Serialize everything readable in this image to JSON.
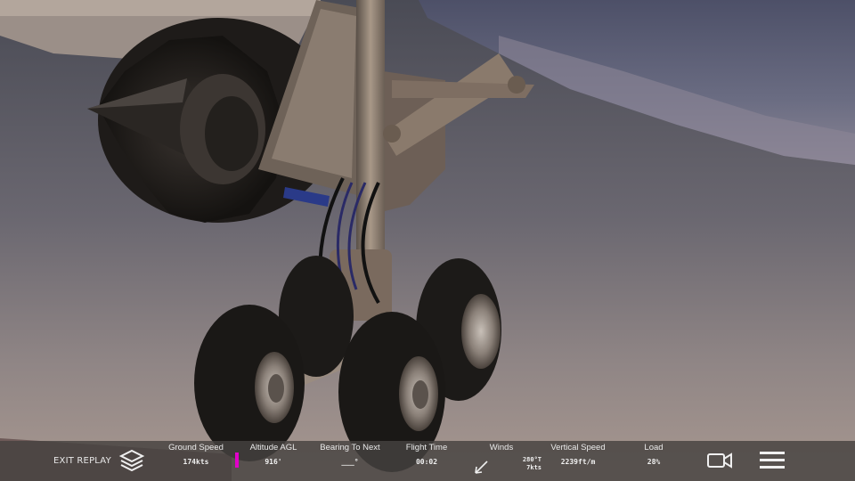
{
  "replay_controls": {
    "exit_label": "EXIT REPLAY"
  },
  "stats": {
    "ground_speed": {
      "label": "Ground Speed",
      "value": "174kts"
    },
    "altitude_agl": {
      "label": "Altitude AGL",
      "value": "916'"
    },
    "bearing_to_next": {
      "label": "Bearing To Next",
      "value": "___°"
    },
    "flight_time": {
      "label": "Flight Time",
      "value": "00:02"
    },
    "winds": {
      "label": "Winds",
      "direction": "280°T",
      "speed": "7kts"
    },
    "vertical_speed": {
      "label": "Vertical Speed",
      "value": "2239ft/m"
    },
    "load": {
      "label": "Load",
      "value": "28%"
    }
  },
  "icons": {
    "layers": "layers-icon",
    "wind_arrow": "wind-arrow-icon",
    "camera": "video-camera-icon",
    "menu": "hamburger-menu-icon"
  },
  "colors": {
    "altitude_bar": "#e000c8",
    "hud_text": "#f0f0f0"
  }
}
